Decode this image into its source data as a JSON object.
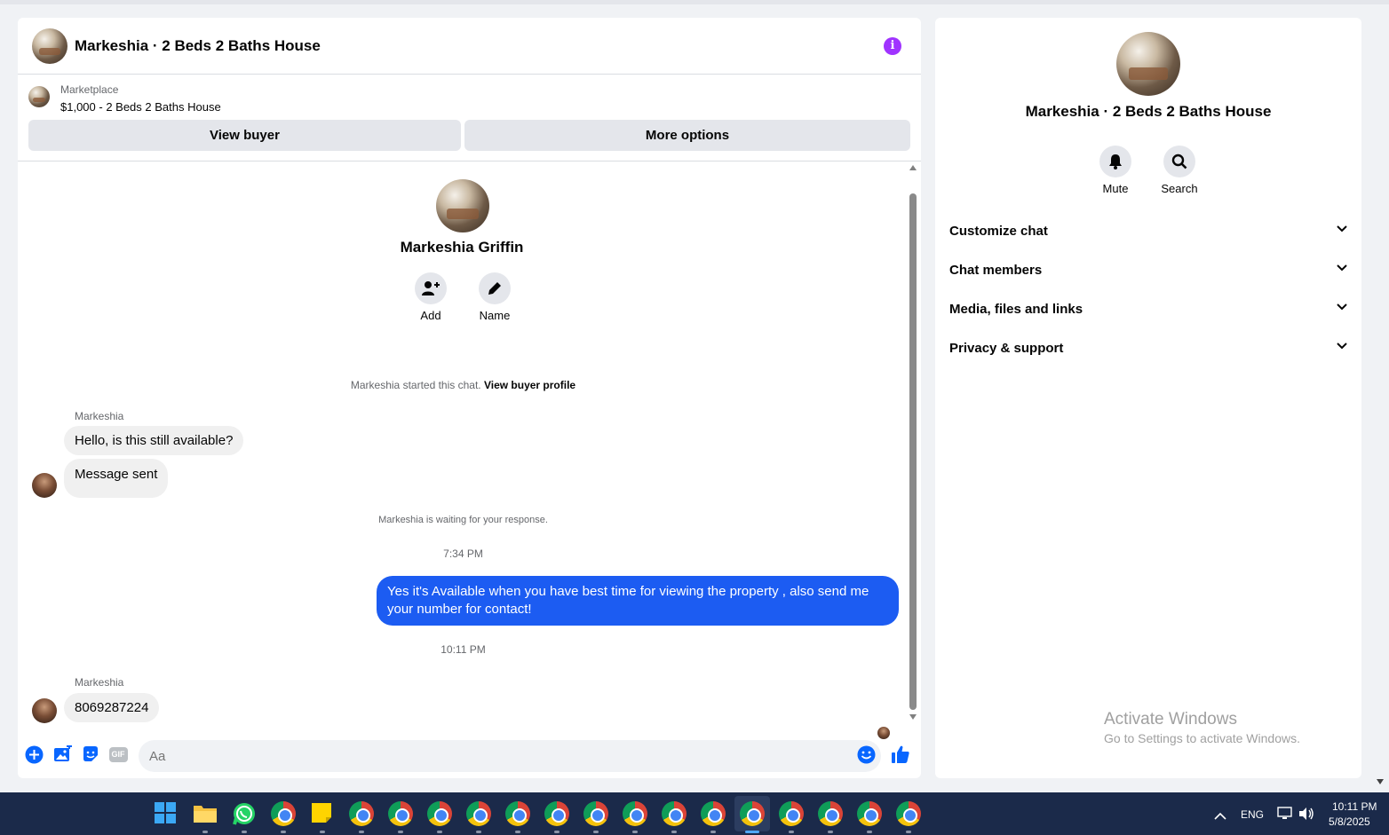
{
  "header": {
    "title": "Markeshia · 2 Beds 2 Baths House",
    "info_icon": "i"
  },
  "marketplace": {
    "label": "Marketplace",
    "price_title": "$1,000 - 2 Beds 2 Baths House",
    "view_buyer": "View buyer",
    "more_options": "More options"
  },
  "profile": {
    "name": "Markeshia Griffin",
    "add_label": "Add",
    "name_label": "Name"
  },
  "conversation": {
    "started_text": "Markeshia started this chat. ",
    "view_profile_link": "View buyer profile",
    "sender1": "Markeshia",
    "msg1": "Hello, is this still available?",
    "msg2": "Message sent",
    "waiting_text": "Markeshia is waiting for your response.",
    "time1": "7:34 PM",
    "out_msg": "Yes it's Available when you have best time for viewing the property , also send me your number for contact!",
    "time2": "10:11 PM",
    "sender2": "Markeshia",
    "msg3": "8069287224"
  },
  "composer": {
    "placeholder": "Aa",
    "gif_label": "GIF"
  },
  "side": {
    "title": "Markeshia · 2 Beds 2 Baths House",
    "mute_label": "Mute",
    "search_label": "Search",
    "sections": [
      "Customize chat",
      "Chat members",
      "Media, files and links",
      "Privacy & support"
    ]
  },
  "watermark": {
    "line1": "Activate Windows",
    "line2": "Go to Settings to activate Windows."
  },
  "taskbar": {
    "lang": "ENG",
    "time": "10:11 PM",
    "date": "5/8/2025"
  },
  "colors": {
    "accent": "#1c5cf2",
    "info": "#a033ff",
    "taskbar": "#1b2a4a"
  }
}
